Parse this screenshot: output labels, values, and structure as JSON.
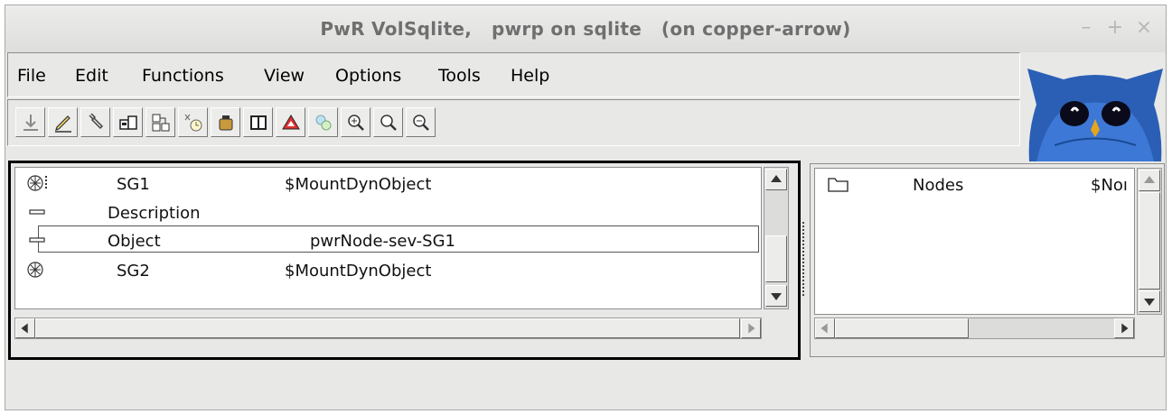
{
  "window": {
    "title": "PwR VolSqlite,   pwrp on sqlite   (on copper-arrow)",
    "minimize_glyph": "–",
    "maximize_glyph": "+",
    "close_glyph": "×"
  },
  "menubar": {
    "items": [
      "File",
      "Edit",
      "Functions",
      "View",
      "Options",
      "Tools",
      "Help"
    ]
  },
  "toolbar": {
    "icons": [
      "import-icon",
      "pencil-icon",
      "wrench-icon",
      "object-copy-icon",
      "hierarchy-icon",
      "plc-timer-icon",
      "pot-icon",
      "book-icon",
      "triangle-icon",
      "connect-icon",
      "zoom-in-icon",
      "zoom-reset-icon",
      "zoom-out-icon"
    ]
  },
  "left_pane": {
    "rows": [
      {
        "name": "SG1",
        "class": "$MountDynObject",
        "icon": "map-icon"
      },
      {
        "name": "Description",
        "class": "",
        "icon": "attribute-icon"
      },
      {
        "name": "Object",
        "class": "pwrNode-sev-SG1",
        "icon": "attribute-icon"
      },
      {
        "name": "SG2",
        "class": "$MountDynObject",
        "icon": "map-icon"
      }
    ]
  },
  "right_pane": {
    "rows": [
      {
        "name": "Nodes",
        "class": "$Noı",
        "icon": "folder-icon"
      }
    ]
  },
  "colors": {
    "window_bg": "#e8e8e7",
    "list_bg": "#ffffff",
    "focus_border": "#000000"
  }
}
